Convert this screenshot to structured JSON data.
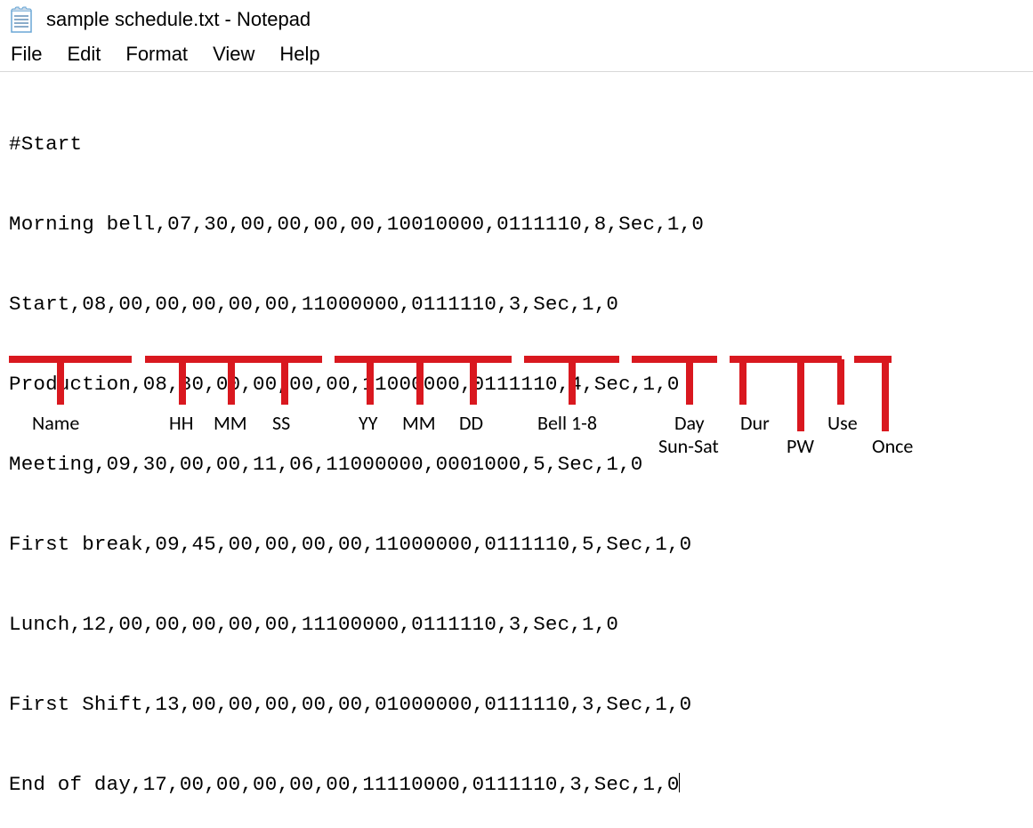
{
  "window": {
    "title": "sample schedule.txt - Notepad",
    "icon": "notepad-icon"
  },
  "menu": {
    "file": "File",
    "edit": "Edit",
    "format": "Format",
    "view": "View",
    "help": "Help"
  },
  "content": {
    "lines": [
      "#Start",
      "Morning bell,07,30,00,00,00,00,10010000,0111110,8,Sec,1,0",
      "Start,08,00,00,00,00,00,11000000,0111110,3,Sec,1,0",
      "Production,08,30,00,00,00,00,11000000,0111110,4,Sec,1,0",
      "Meeting,09,30,00,00,11,06,11000000,0001000,5,Sec,1,0",
      "First break,09,45,00,00,00,00,11000000,0111110,5,Sec,1,0",
      "Lunch,12,00,00,00,00,00,11100000,0111110,3,Sec,1,0",
      "First Shift,13,00,00,00,00,00,01000000,0111110,3,Sec,1,0",
      "End of day,17,00,00,00,00,00,11110000,0111110,3,Sec,1,0"
    ]
  },
  "annotations": {
    "labels": {
      "name": "Name",
      "hh": "HH",
      "mm": "MM",
      "ss": "SS",
      "yy": "YY",
      "mm2": "MM",
      "dd": "DD",
      "bell": "Bell 1-8",
      "day": "Day",
      "daysub": "Sun-Sat",
      "dur": "Dur",
      "pw": "PW",
      "use": "Use",
      "once": "Once"
    }
  }
}
